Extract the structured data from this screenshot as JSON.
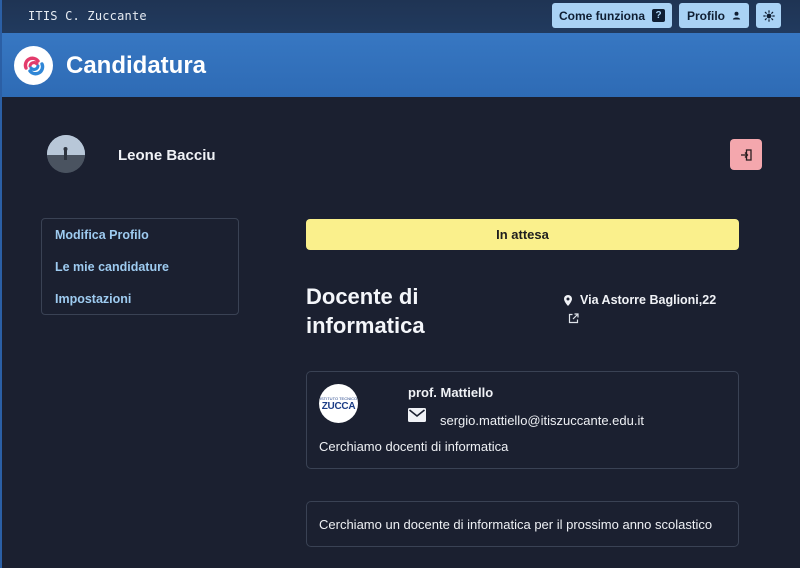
{
  "topbar": {
    "brand": "ITIS C. Zuccante",
    "how_it_works_label": "Come funziona",
    "profile_label": "Profilo",
    "icons": [
      "question-icon",
      "person-icon",
      "sun-icon"
    ]
  },
  "header": {
    "title": "Candidatura"
  },
  "user": {
    "name": "Leone Bacciu"
  },
  "sidebar": {
    "items": [
      {
        "label": "Modifica Profilo"
      },
      {
        "label": "Le mie candidature"
      },
      {
        "label": "Impostazioni"
      }
    ]
  },
  "application": {
    "status": "In attesa",
    "title": "Docente di informatica",
    "address": "Via Astorre Baglioni,22",
    "company": {
      "logo_text": "ZUCCA",
      "contact_name": "prof. Mattiello",
      "contact_email": "sergio.mattiello@itiszuccante.edu.it",
      "short_description": "Cerchiamo docenti di informatica"
    },
    "long_description": "Cerchiamo un docente di informatica per il prossimo anno scolastico"
  },
  "colors": {
    "topbar_bg": "#213a5e",
    "hero_bg": "#3373bd",
    "page_bg": "#1b2030",
    "button_bg": "#a9d2f5",
    "status_bg": "#faf08c",
    "logout_bg": "#f4a7ad",
    "link_color": "#9ecbf0"
  }
}
